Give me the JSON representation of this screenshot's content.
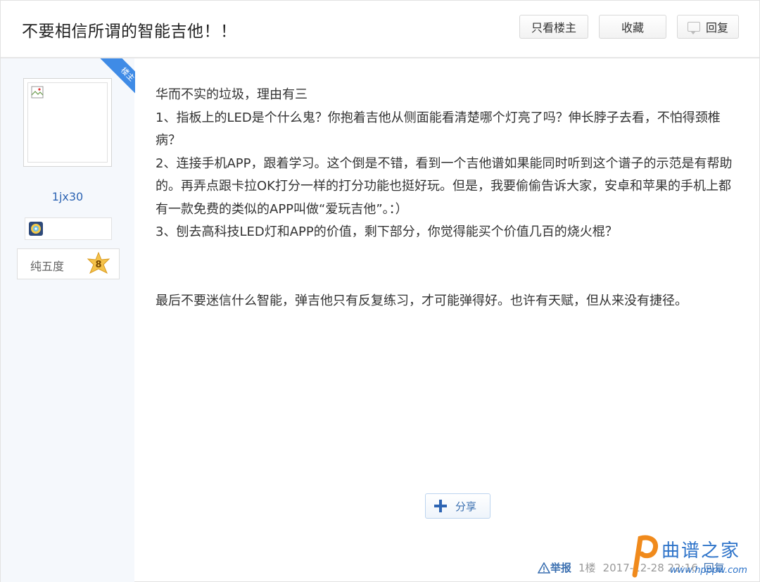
{
  "header": {
    "title": "不要相信所谓的智能吉他！！",
    "buttons": {
      "only_owner": "只看楼主",
      "favorite": "收藏",
      "reply": "回复"
    }
  },
  "author": {
    "badge": "楼主",
    "username": "1jx30",
    "level_name": "纯五度",
    "level_number": "8"
  },
  "post": {
    "paragraphs": [
      "华而不实的垃圾，理由有三",
      "1、指板上的LED是个什么鬼？你抱着吉他从侧面能看清楚哪个灯亮了吗？伸长脖子去看，不怕得颈椎病？",
      "2、连接手机APP，跟着学习。这个倒是不错，看到一个吉他谱如果能同时听到这个谱子的示范是有帮助的。再弄点跟卡拉OK打分一样的打分功能也挺好玩。但是，我要偷偷告诉大家，安卓和苹果的手机上都有一款免费的类似的APP叫做“爱玩吉他”。：）",
      "3、刨去高科技LED灯和APP的价值，剩下部分，你觉得能买个价值几百的烧火棍？"
    ],
    "closing": "最后不要迷信什么智能，弹吉他只有反复练习，才可能弹得好。也许有天赋，但从来没有捷径。"
  },
  "share": {
    "label": "分享"
  },
  "footer": {
    "report": "举报",
    "floor": "1楼",
    "time": "2017-12-28 22:16",
    "reply": "回复"
  },
  "watermark": {
    "text": "曲谱之家",
    "url": "www.hpppw.com"
  },
  "colors": {
    "accent": "#3f8be6",
    "link": "#2d64b3",
    "sidebar_bg": "#f5f8fc"
  }
}
